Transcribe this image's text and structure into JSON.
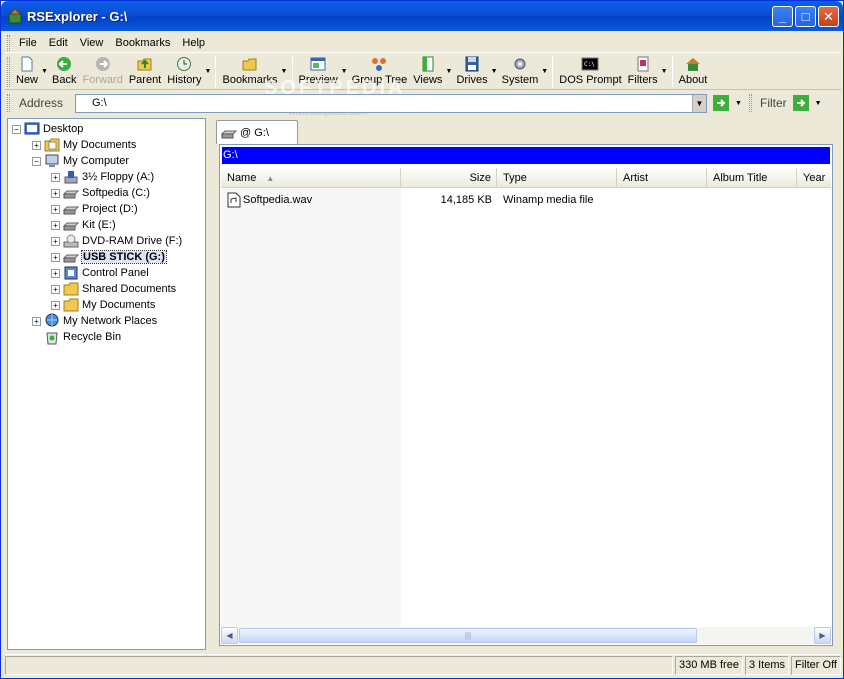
{
  "window": {
    "title": "RSExplorer - G:\\",
    "minimize": "_",
    "maximize": "□",
    "close": "✕"
  },
  "menu": [
    "File",
    "Edit",
    "View",
    "Bookmarks",
    "Help"
  ],
  "toolbar": {
    "new": "New",
    "back": "Back",
    "forward": "Forward",
    "parent": "Parent",
    "history": "History",
    "bookmarks": "Bookmarks",
    "preview": "Preview",
    "group_tree": "Group Tree",
    "views": "Views",
    "drives": "Drives",
    "system": "System",
    "dos_prompt": "DOS Prompt",
    "filters": "Filters",
    "about": "About"
  },
  "address": {
    "label": "Address",
    "value": "G:\\",
    "filter_label": "Filter"
  },
  "tree": {
    "desktop": "Desktop",
    "my_documents": "My Documents",
    "my_computer": "My Computer",
    "floppy": "3½ Floppy (A:)",
    "softpedia": "Softpedia (C:)",
    "project": "Project (D:)",
    "kit": "Kit (E:)",
    "dvd": "DVD-RAM Drive (F:)",
    "usb": "USB STICK (G:)",
    "control_panel": "Control Panel",
    "shared_docs": "Shared Documents",
    "my_documents2": "My Documents",
    "network": "My Network Places",
    "recycle": "Recycle Bin"
  },
  "tab": {
    "label": "@ G:\\"
  },
  "path": "G:\\",
  "columns": [
    "Name",
    "Size",
    "Type",
    "Artist",
    "Album Title",
    "Year"
  ],
  "files": [
    {
      "name": "Softpedia.wav",
      "size": "14,185 KB",
      "type": "Winamp media file"
    }
  ],
  "status": {
    "free": "330 MB free",
    "items": "3 Items",
    "filter": "Filter Off"
  },
  "watermark": {
    "main": "SOFTPEDIA",
    "sub": "www.softpedia.com"
  },
  "colors": {
    "title_blue": "#0a5fe8",
    "path_bar": "#0000ff"
  }
}
